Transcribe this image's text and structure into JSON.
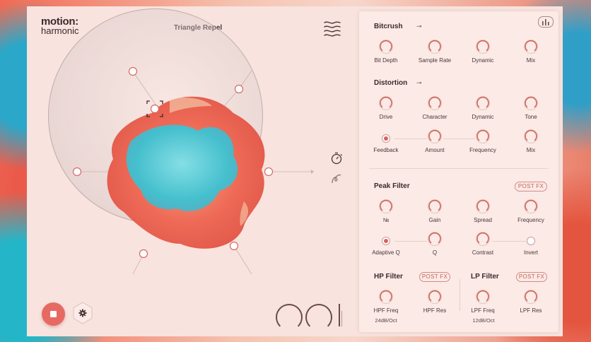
{
  "app": {
    "logo_line1": "motion:",
    "logo_line2": "harmonic",
    "preset_name": "Triangle Repel"
  },
  "colors": {
    "accent": "#e0605a",
    "blob_red": "#ee6a56",
    "blob_cyan": "#3cc3d3"
  },
  "icons": {
    "waves": "waves-icon",
    "timer": "timer-icon",
    "curve": "curve-icon",
    "stop": "stop-icon",
    "settings": "gear-icon",
    "chart": "bar-chart-icon"
  },
  "bitcrush": {
    "title": "Bitcrush",
    "bypass_glyph": "⊸",
    "knobs": [
      "Bit Depth",
      "Sample Rate",
      "Dynamic",
      "Mix"
    ]
  },
  "distortion": {
    "title": "Distortion",
    "bypass_glyph": "⊸",
    "knobs_row1": [
      "Drive",
      "Character",
      "Dynamic",
      "Tone"
    ],
    "knobs_row2": [
      "Feedback",
      "Amount",
      "Frequency",
      "Mix"
    ]
  },
  "peak_filter": {
    "title": "Peak Filter",
    "post_fx": "POST FX",
    "knobs_row1": [
      "№",
      "Gain",
      "Spread",
      "Frequency"
    ],
    "knobs_row2": [
      "Adaptive Q",
      "Q",
      "Contrast",
      "Invert"
    ]
  },
  "hp_filter": {
    "title": "HP Filter",
    "post_fx": "POST FX",
    "knobs": [
      "HPF Freq",
      "HPF Res"
    ],
    "slope": "24dB/Oct"
  },
  "lp_filter": {
    "title": "LP Filter",
    "post_fx": "POST FX",
    "knobs": [
      "LPF Freq",
      "LPF Res"
    ],
    "slope": "12dB/Oct"
  }
}
